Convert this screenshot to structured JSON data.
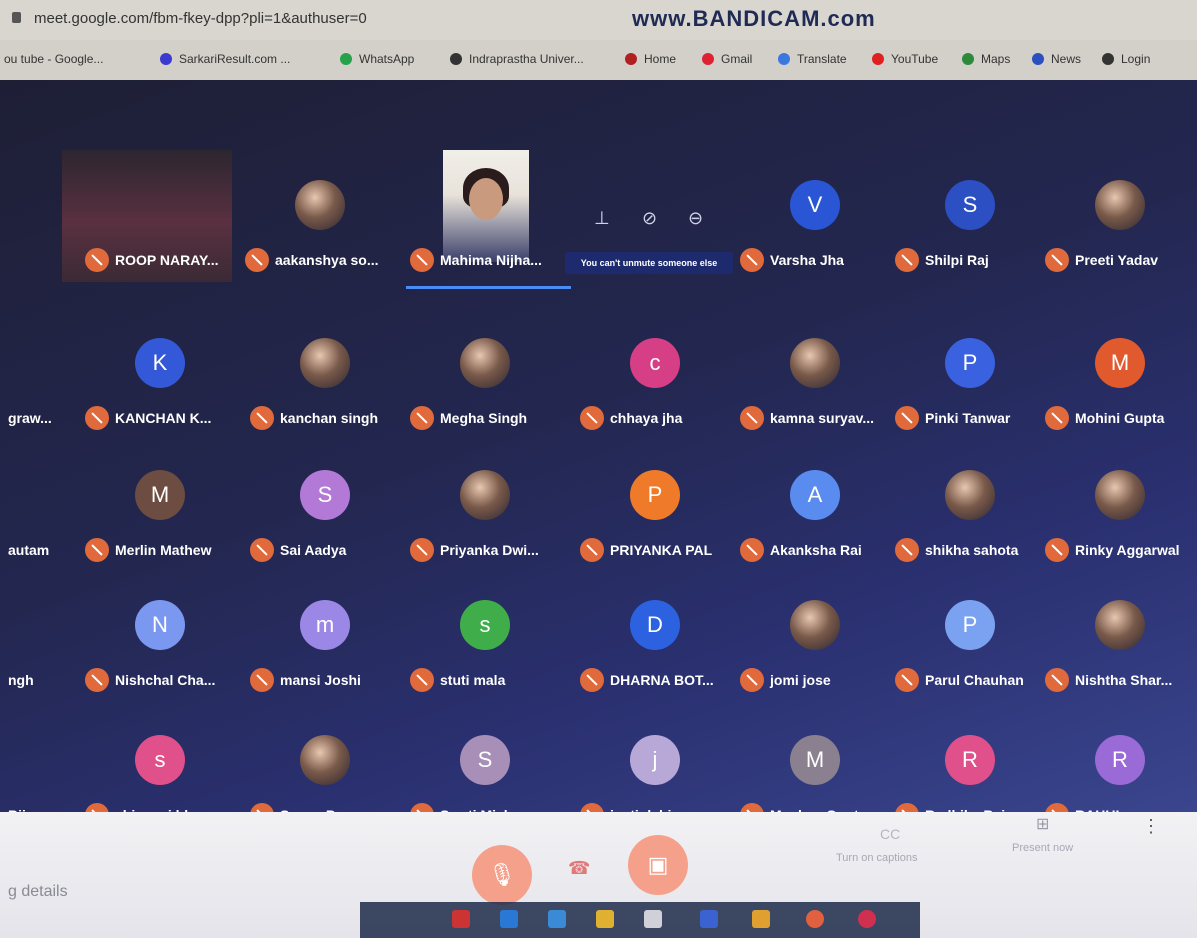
{
  "browser": {
    "url": "meet.google.com/fbm-fkey-dpp?pli=1&authuser=0",
    "watermark": "www.BANDICAM.com"
  },
  "bookmarks": [
    {
      "label": "ou tube - Google...",
      "color": "#c33"
    },
    {
      "label": "SarkariResult.com ...",
      "color": "#3a3ad0"
    },
    {
      "label": "WhatsApp",
      "color": "#25a24a"
    },
    {
      "label": "Indraprastha Univer...",
      "color": "#333"
    },
    {
      "label": "Home",
      "color": "#b02020"
    },
    {
      "label": "Gmail",
      "color": "#d23"
    },
    {
      "label": "Translate",
      "color": "#3a78e0"
    },
    {
      "label": "YouTube",
      "color": "#e02020"
    },
    {
      "label": "Maps",
      "color": "#2c8a3a"
    },
    {
      "label": "News",
      "color": "#2a4fbf"
    },
    {
      "label": "Login",
      "color": "#333"
    }
  ],
  "tooltip": "You can't unmute someone else",
  "participants": [
    {
      "name": "ROOP NARAY...",
      "type": "video",
      "initial": "",
      "color": ""
    },
    {
      "name": "aakanshya so...",
      "type": "photo",
      "initial": "",
      "color": ""
    },
    {
      "name": "Mahima Nijha...",
      "type": "video",
      "initial": "",
      "color": ""
    },
    {
      "name": "Varsha Jha",
      "type": "letter",
      "initial": "V",
      "color": "#2a56d6"
    },
    {
      "name": "Shilpi Raj",
      "type": "letter",
      "initial": "S",
      "color": "#2c4fc4"
    },
    {
      "name": "Preeti Yadav",
      "type": "photo",
      "initial": "",
      "color": ""
    },
    {
      "name": "graw...",
      "type": "none",
      "initial": "",
      "color": ""
    },
    {
      "name": "KANCHAN K...",
      "type": "letter",
      "initial": "K",
      "color": "#3358d8"
    },
    {
      "name": "kanchan singh",
      "type": "photo",
      "initial": "",
      "color": ""
    },
    {
      "name": "Megha Singh",
      "type": "photo",
      "initial": "",
      "color": ""
    },
    {
      "name": "chhaya jha",
      "type": "letter",
      "initial": "c",
      "color": "#d63f86"
    },
    {
      "name": "kamna suryav...",
      "type": "photo",
      "initial": "",
      "color": ""
    },
    {
      "name": "Pinki Tanwar",
      "type": "letter",
      "initial": "P",
      "color": "#3a62e0"
    },
    {
      "name": "Mohini Gupta",
      "type": "letter",
      "initial": "M",
      "color": "#e05a2e"
    },
    {
      "name": "autam",
      "type": "none",
      "initial": "",
      "color": ""
    },
    {
      "name": "Merlin Mathew",
      "type": "letter",
      "initial": "M",
      "color": "#6d4c41"
    },
    {
      "name": "Sai Aadya",
      "type": "letter",
      "initial": "S",
      "color": "#b27ad6"
    },
    {
      "name": "Priyanka Dwi...",
      "type": "photo",
      "initial": "",
      "color": ""
    },
    {
      "name": "PRIYANKA PAL",
      "type": "letter",
      "initial": "P",
      "color": "#ef7a2a"
    },
    {
      "name": "Akanksha Rai",
      "type": "letter",
      "initial": "A",
      "color": "#5a8cf0"
    },
    {
      "name": "shikha sahota",
      "type": "photo",
      "initial": "",
      "color": ""
    },
    {
      "name": "Rinky Aggarwal",
      "type": "photo",
      "initial": "",
      "color": ""
    },
    {
      "name": "ngh",
      "type": "none",
      "initial": "",
      "color": ""
    },
    {
      "name": "Nishchal Cha...",
      "type": "letter",
      "initial": "N",
      "color": "#7a98f0"
    },
    {
      "name": "mansi Joshi",
      "type": "letter",
      "initial": "m",
      "color": "#9b88e6"
    },
    {
      "name": "stuti mala",
      "type": "letter",
      "initial": "s",
      "color": "#3fae4a"
    },
    {
      "name": "DHARNA BOT...",
      "type": "letter",
      "initial": "D",
      "color": "#2c62e0"
    },
    {
      "name": "jomi jose",
      "type": "photo",
      "initial": "",
      "color": ""
    },
    {
      "name": "Parul Chauhan",
      "type": "letter",
      "initial": "P",
      "color": "#7aa2f0"
    },
    {
      "name": "Nishtha Shar...",
      "type": "photo",
      "initial": "",
      "color": ""
    },
    {
      "name": "Biju",
      "type": "none",
      "initial": "",
      "color": ""
    },
    {
      "name": "shivangi bhar...",
      "type": "letter",
      "initial": "s",
      "color": "#e0508a"
    },
    {
      "name": "Sapna Paneru",
      "type": "photo",
      "initial": "",
      "color": ""
    },
    {
      "name": "Swati Mishra",
      "type": "letter",
      "initial": "S",
      "color": "#a78fb8"
    },
    {
      "name": "jyoti dahiya",
      "type": "letter",
      "initial": "j",
      "color": "#b8a8d8"
    },
    {
      "name": "Muskan Gupta",
      "type": "letter",
      "initial": "M",
      "color": "#8a8090"
    },
    {
      "name": "Radhika Bajw...",
      "type": "letter",
      "initial": "R",
      "color": "#e0508a"
    },
    {
      "name": "RAHUL",
      "type": "letter",
      "initial": "R",
      "color": "#9a6ad6"
    }
  ],
  "bottom_bar": {
    "meeting_details": "g details",
    "captions_label": "Turn on captions",
    "present_label": "Present now"
  }
}
